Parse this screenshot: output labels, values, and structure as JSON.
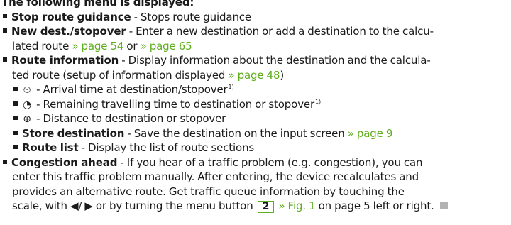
{
  "intro": "The following menu is displayed:",
  "items": {
    "stop": {
      "label": "Stop route guidance",
      "desc": " - Stops route guidance"
    },
    "newdest": {
      "label": "New dest./stopover",
      "desc1": " - Enter a new destination or add a destination to the calcu-",
      "desc2a": "lated route ",
      "link1": "» page 54",
      "or": " or ",
      "link2": "» page 65"
    },
    "routeinfo": {
      "label": "Route information",
      "desc1": " - Display information about the destination and the calcula-",
      "desc2a": "ted route (setup of information displayed ",
      "link": "» page 48",
      "desc2b": ")"
    },
    "arrival": {
      "icon": "⏲",
      "text": " - Arrival time at destination/stopover",
      "sup": "1)"
    },
    "remaining": {
      "icon": "◔",
      "text": " - Remaining travelling time to destination or stopover",
      "sup": "1)"
    },
    "distance": {
      "icon": "⊕",
      "text": " - Distance to destination or stopover"
    },
    "store": {
      "label": "Store destination",
      "desc": " - Save the destination on the input screen ",
      "link": "» page 9"
    },
    "routelist": {
      "label": "Route list",
      "desc": " - Display the list of route sections"
    },
    "congestion": {
      "label": "Congestion ahead",
      "desc1": " - If you hear of a traffic problem (e.g. congestion), you can",
      "line2": "enter this traffic problem manually. After entering, the device recalculates and",
      "line3": "provides an alternative route. Get traffic queue information by touching the",
      "line4a": "scale, with ◀/ ▶ or by turning the menu button ",
      "key": "2",
      "link": "» Fig. 1",
      "line4b": " on page 5 left or right."
    }
  },
  "colors": {
    "link": "#5fae1e",
    "text": "#1a1a1a",
    "endmark": "#b3b3b3"
  }
}
